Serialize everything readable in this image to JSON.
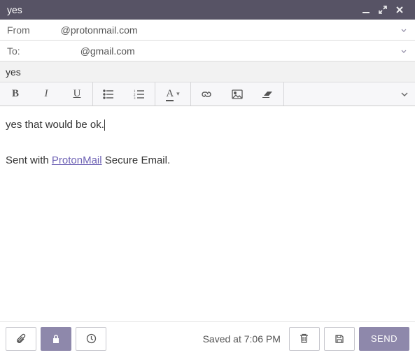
{
  "titlebar": {
    "title": "yes"
  },
  "from": {
    "label": "From",
    "value": "@protonmail.com"
  },
  "to": {
    "label": "To:",
    "value": "@gmail.com"
  },
  "subject": {
    "value": "yes"
  },
  "editor": {
    "bold": "B",
    "italic": "I",
    "underline": "U",
    "font_color_label": "A"
  },
  "body": {
    "line1": "yes that would be ok.",
    "sig_prefix": "Sent with ",
    "sig_link": "ProtonMail",
    "sig_suffix": " Secure Email."
  },
  "footer": {
    "saved": "Saved at 7:06 PM",
    "send": "SEND"
  }
}
